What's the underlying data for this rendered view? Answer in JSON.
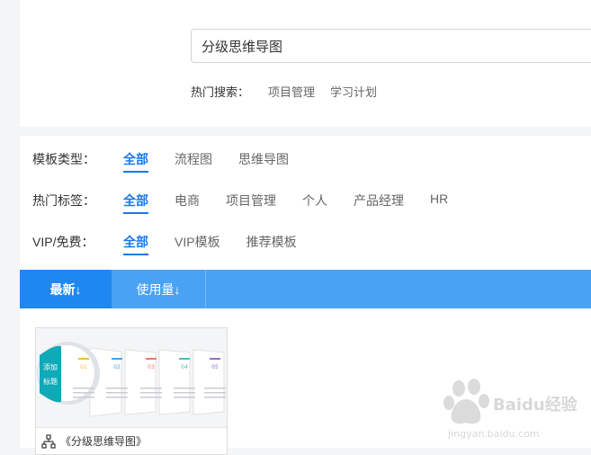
{
  "search": {
    "value": "分级思维导图"
  },
  "hot_search": {
    "label": "热门搜索：",
    "keywords": [
      "项目管理",
      "学习计划"
    ]
  },
  "filters": [
    {
      "label": "模板类型：",
      "options": [
        "全部",
        "流程图",
        "思维导图"
      ]
    },
    {
      "label": "热门标签：",
      "options": [
        "全部",
        "电商",
        "项目管理",
        "个人",
        "产品经理",
        "HR"
      ]
    },
    {
      "label": "VIP/免费：",
      "options": [
        "全部",
        "VIP模板",
        "推荐模板"
      ]
    }
  ],
  "sort": {
    "latest": "最新↓",
    "usage": "使用量↓"
  },
  "card": {
    "title": "《分级思维导图》",
    "thumb": {
      "circle_text": "添加标题",
      "numbers": [
        "01",
        "02",
        "03",
        "04",
        "05"
      ],
      "accent_colors": [
        "#f5b942",
        "#3aa7e8",
        "#f07a6a",
        "#45c0b0",
        "#9a6cc4"
      ]
    }
  },
  "watermark": {
    "text": "Baidu经验",
    "url_text": "jingyan.baidu.com"
  }
}
